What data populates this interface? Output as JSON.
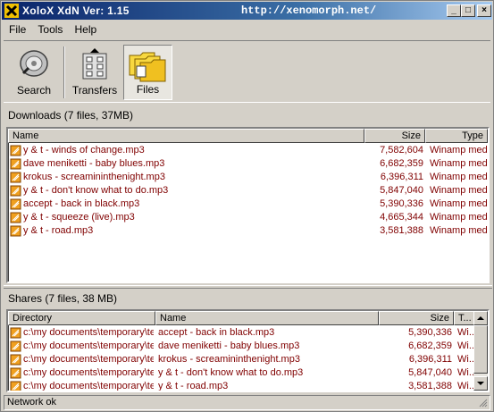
{
  "window": {
    "title": "XoloX XdN Ver: 1.15",
    "url": "http://xenomorph.net/",
    "buttons": {
      "minimize": "_",
      "maximize": "□",
      "close": "×"
    }
  },
  "menu": [
    "File",
    "Tools",
    "Help"
  ],
  "toolbar": {
    "search_label": "Search",
    "transfers_label": "Transfers",
    "files_label": "Files",
    "active": "files"
  },
  "downloads": {
    "title": "Downloads (7 files, 37MB)",
    "columns": [
      "Name",
      "Size",
      "Type"
    ],
    "rows": [
      {
        "name": "y & t - winds of change.mp3",
        "size": "7,582,604",
        "type": "Winamp medi..."
      },
      {
        "name": "dave meniketti - baby blues.mp3",
        "size": "6,682,359",
        "type": "Winamp medi..."
      },
      {
        "name": "krokus - screamininthenight.mp3",
        "size": "6,396,311",
        "type": "Winamp medi..."
      },
      {
        "name": "y & t - don't know what to do.mp3",
        "size": "5,847,040",
        "type": "Winamp medi..."
      },
      {
        "name": "accept - back in black.mp3",
        "size": "5,390,336",
        "type": "Winamp medi..."
      },
      {
        "name": "y & t - squeeze (live).mp3",
        "size": "4,665,344",
        "type": "Winamp medi..."
      },
      {
        "name": "y & t - road.mp3",
        "size": "3,581,388",
        "type": "Winamp medi..."
      }
    ]
  },
  "shares": {
    "title": "Shares (7 files, 38 MB)",
    "columns": [
      "Directory",
      "Name",
      "Size",
      "T..."
    ],
    "rows": [
      {
        "dir": "c:\\my documents\\temporary\\te...",
        "name": "accept - back in black.mp3",
        "size": "5,390,336",
        "type": "Wi..."
      },
      {
        "dir": "c:\\my documents\\temporary\\te...",
        "name": "dave meniketti - baby blues.mp3",
        "size": "6,682,359",
        "type": "Wi..."
      },
      {
        "dir": "c:\\my documents\\temporary\\te...",
        "name": "krokus - screamininthenight.mp3",
        "size": "6,396,311",
        "type": "Wi..."
      },
      {
        "dir": "c:\\my documents\\temporary\\te...",
        "name": "y & t - don't know what to do.mp3",
        "size": "5,847,040",
        "type": "Wi..."
      },
      {
        "dir": "c:\\my documents\\temporary\\te...",
        "name": "y & t - road.mp3",
        "size": "3,581,388",
        "type": "Wi..."
      }
    ]
  },
  "status": "Network ok",
  "colors": {
    "row_text": "#800000",
    "title_bar": "#0a246a",
    "face": "#d4d0c8"
  }
}
